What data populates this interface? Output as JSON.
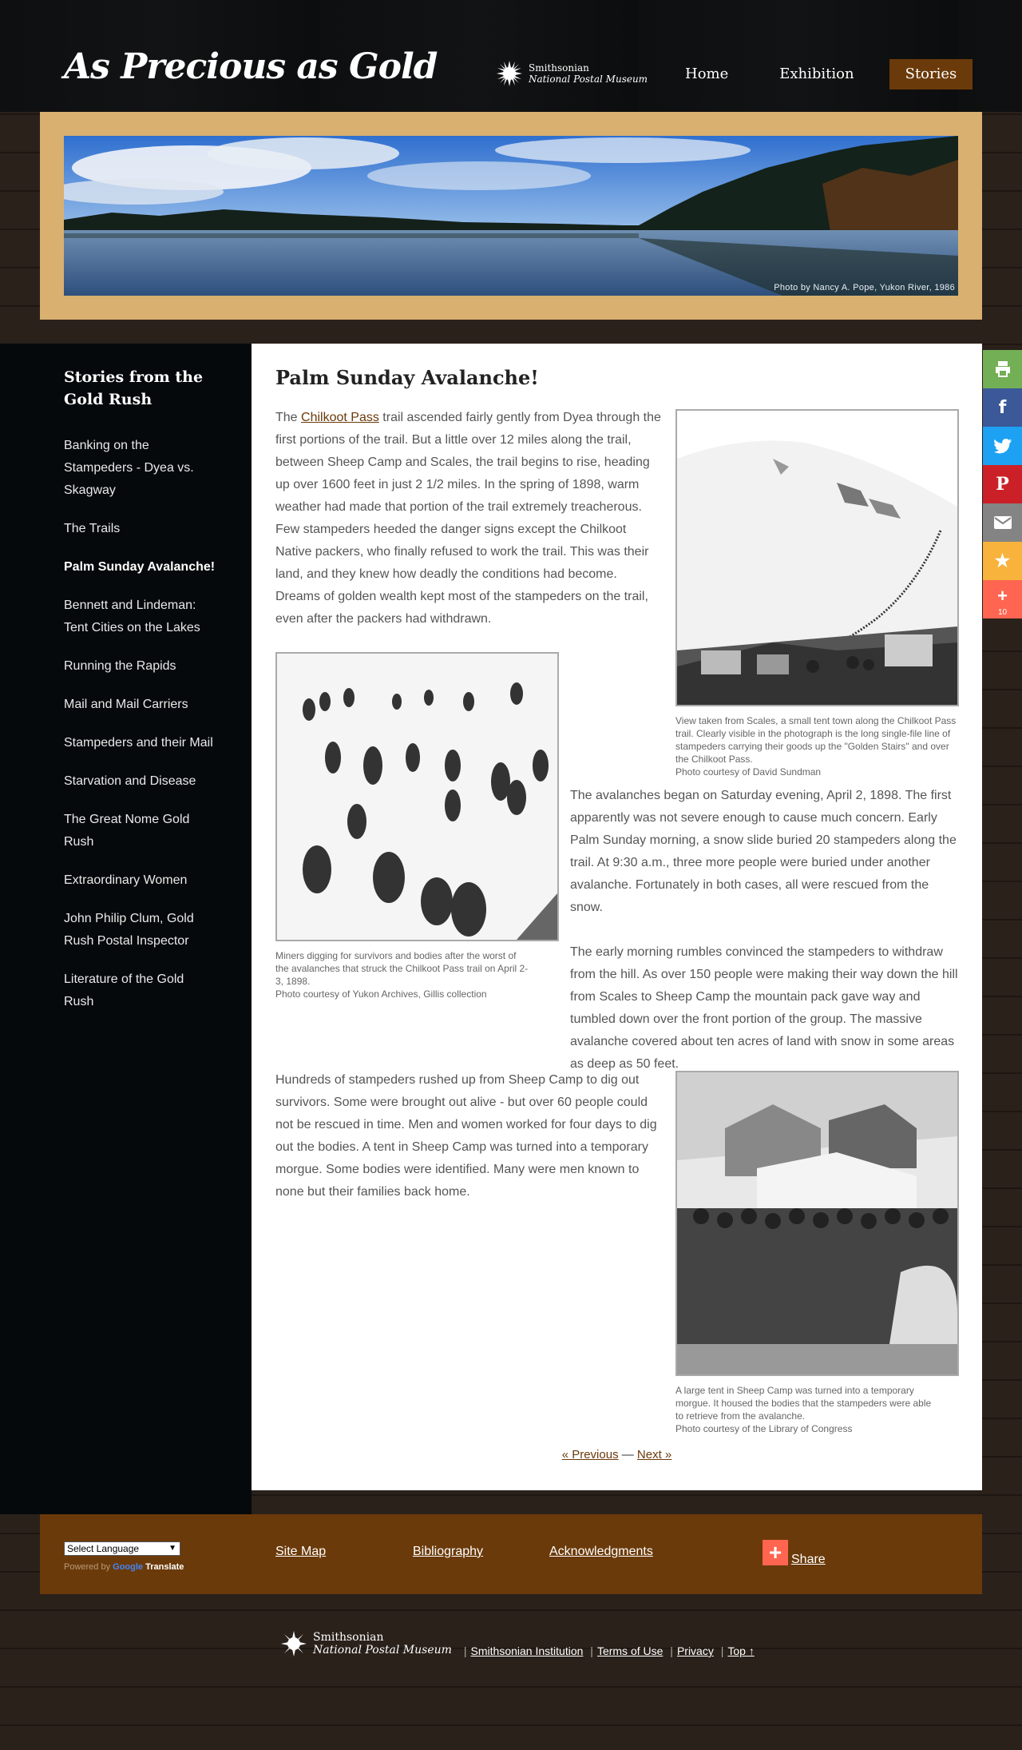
{
  "header": {
    "site_title": "As Precious as Gold",
    "logo_line1": "Smithsonian",
    "logo_line2": "National Postal Museum",
    "nav": [
      "Home",
      "Exhibition",
      "Stories"
    ],
    "active_nav": "Stories"
  },
  "hero": {
    "credit": "Photo by Nancy A. Pope, Yukon River, 1986"
  },
  "sidebar": {
    "title": "Stories from the Gold Rush",
    "items": [
      "Banking on the Stampeders - Dyea vs. Skagway",
      "The Trails",
      "Palm Sunday Avalanche!",
      "Bennett and Lindeman: Tent Cities on the Lakes",
      "Running the Rapids",
      "Mail and Mail Carriers",
      "Stampeders and their Mail",
      "Starvation and Disease",
      "The Great Nome Gold Rush",
      "Extraordinary Women",
      "John Philip Clum, Gold Rush Postal Inspector",
      "Literature of the Gold Rush"
    ],
    "current": "Palm Sunday Avalanche!"
  },
  "article": {
    "title": "Palm Sunday Avalanche!",
    "p1_pre": "The ",
    "p1_link": "Chilkoot Pass",
    "p1_post": " trail ascended fairly gently from Dyea through the first portions of the trail. But a little over 12 miles along the trail, between Sheep Camp and Scales, the trail begins to rise, heading up over 1600 feet in just 2 1/2 miles. In the spring of 1898, warm weather had made that portion of the trail extremely treacherous. Few stampeders heeded the danger signs except the Chilkoot Native packers, who finally refused to work the trail. This was their land, and they knew how deadly the conditions had become. Dreams of golden wealth kept most of the stampeders on the trail, even after the packers had withdrawn.",
    "p2": "The avalanches began on Saturday evening, April 2, 1898. The first apparently was not severe enough to cause much concern. Early Palm Sunday morning, a snow slide buried 20 stampeders along the trail. At 9:30 a.m., three more people were buried under another avalanche. Fortunately in both cases, all were rescued from the snow.",
    "p3": "The early morning rumbles convinced the stampeders to withdraw from the hill. As over 150 people were making their way down the hill from Scales to Sheep Camp the mountain pack gave way and tumbled down over the front portion of the group. The massive avalanche covered about ten acres of land with snow in some areas as deep as 50 feet.",
    "p4": "Hundreds of stampeders rushed up from Sheep Camp to dig out survivors. Some were brought out alive - but over 60 people could not be rescued in time. Men and women worked for four days to dig out the bodies. A tent in Sheep Camp was turned into a temporary morgue. Some bodies were identified. Many were men known to none but their families back home.",
    "caption1": "View taken from Scales, a small tent town along the Chilkoot Pass trail. Clearly visible in the photograph is the long single-file line of stampeders carrying their goods up the \"Golden Stairs\" and over the Chilkoot Pass.",
    "credit1": "Photo courtesy of David Sundman",
    "caption2": "Miners digging for survivors and bodies after the worst of the avalanches that struck the Chilkoot Pass trail on April 2-3, 1898.",
    "credit2": "Photo courtesy of Yukon Archives, Gillis collection",
    "caption3": "A large tent in Sheep Camp was turned into a temporary morgue. It housed the bodies that the stampeders were able to retrieve from the avalanche.",
    "credit3": "Photo courtesy of the Library of Congress",
    "prev": "« Previous",
    "dash": " — ",
    "next": "Next »"
  },
  "share_bar": {
    "count": "10"
  },
  "footer": {
    "language": "Select Language",
    "powered_by": "Powered by",
    "google": "Google",
    "translate": "Translate",
    "links": [
      "Site Map",
      "Bibliography",
      "Acknowledgments"
    ],
    "share": "Share"
  },
  "bottom": {
    "logo_line1": "Smithsonian",
    "logo_line2": "National Postal Museum",
    "links": [
      "Smithsonian Institution",
      "Terms of Use",
      "Privacy",
      "Top ↑"
    ]
  }
}
